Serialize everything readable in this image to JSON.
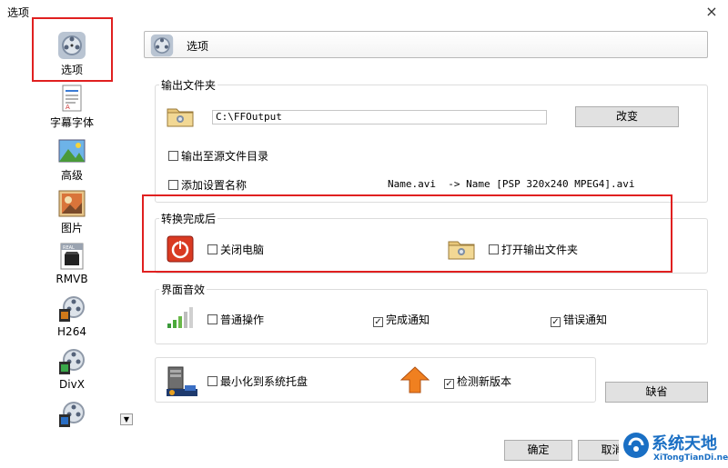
{
  "window": {
    "title": "选项",
    "close_label": "×"
  },
  "sidebar": {
    "items": [
      {
        "label": "选项",
        "icon": "options-film-reel-icon"
      },
      {
        "label": "字幕字体",
        "icon": "subtitle-doc-icon"
      },
      {
        "label": "高级",
        "icon": "advanced-image-icon"
      },
      {
        "label": "图片",
        "icon": "picture-icon"
      },
      {
        "label": "RMVB",
        "icon": "rmvb-clapper-icon"
      },
      {
        "label": "H264",
        "icon": "h264-film-reel-icon"
      },
      {
        "label": "DivX",
        "icon": "divx-film-reel-icon"
      },
      {
        "label": "",
        "icon": "film-reel-icon"
      }
    ],
    "scroll_down": "▼"
  },
  "header": {
    "title": "选项"
  },
  "output_folder": {
    "legend": "输出文件夹",
    "path": "C:\\FFOutput",
    "change_button": "改变",
    "output_to_source": {
      "label": "输出至源文件目录",
      "checked": false
    },
    "add_setting_name": {
      "label": "添加设置名称",
      "checked": false
    },
    "example": "Name.avi  -> Name [PSP 320x240 MPEG4].avi"
  },
  "after_convert": {
    "legend": "转换完成后",
    "shutdown": {
      "label": "关闭电脑",
      "checked": false
    },
    "open_output": {
      "label": "打开输出文件夹",
      "checked": false
    }
  },
  "sound": {
    "legend": "界面音效",
    "normal_op": {
      "label": "普通操作",
      "checked": false
    },
    "done_notify": {
      "label": "完成通知",
      "checked": true
    },
    "error_notify": {
      "label": "错误通知",
      "checked": true
    }
  },
  "misc": {
    "minimize_tray": {
      "label": "最小化到系统托盘",
      "checked": false
    },
    "check_update": {
      "label": "检测新版本",
      "checked": true
    },
    "default_button": "缺省"
  },
  "footer": {
    "ok_button": "确定",
    "cancel_button": "取消"
  },
  "watermark": {
    "title": "系统天地",
    "url": "XiTongTianDi.net"
  },
  "colors": {
    "highlight": "#e02020",
    "accent_blue": "#1a6fc4"
  }
}
